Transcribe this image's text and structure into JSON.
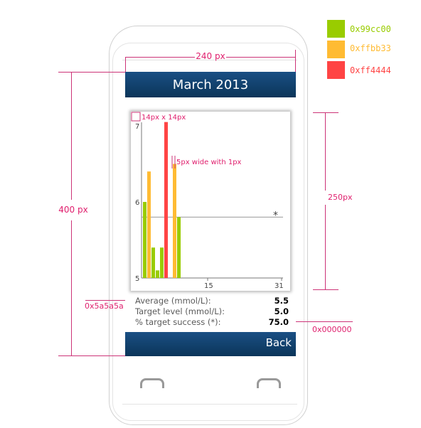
{
  "screen": {
    "title": "March 2013",
    "back_label": "Back"
  },
  "chart_data": {
    "type": "bar",
    "x_range": [
      1,
      31
    ],
    "x_ticks": [
      "15",
      "31"
    ],
    "y_range": [
      5,
      7
    ],
    "y_ticks": [
      "5",
      "6",
      "7"
    ],
    "target_value": 5.8,
    "target_marker": "*",
    "bars": [
      {
        "day": 1,
        "value": 6.0,
        "color": "#99cc00"
      },
      {
        "day": 2,
        "value": 6.4,
        "color": "#ffbb33"
      },
      {
        "day": 3,
        "value": 5.4,
        "color": "#99cc00"
      },
      {
        "day": 4,
        "value": 5.1,
        "color": "#99cc00"
      },
      {
        "day": 5,
        "value": 5.4,
        "color": "#99cc00"
      },
      {
        "day": 6,
        "value": 7.05,
        "color": "#ff4444"
      },
      {
        "day": 8,
        "value": 6.5,
        "color": "#ffbb33"
      },
      {
        "day": 9,
        "value": 5.8,
        "color": "#99cc00"
      }
    ]
  },
  "stats": [
    {
      "label": "Average (mmol/L):",
      "value": "5.5"
    },
    {
      "label": "Target level (mmol/L):",
      "value": "5.0"
    },
    {
      "label": "% target success (*):",
      "value": "75.0"
    }
  ],
  "annotations": {
    "width_label": "240 px",
    "height_label": "400 px",
    "chart_height_label": "250px",
    "marker_size_label": "14px x 14px",
    "bar_width_label": "5px wide with 1px",
    "text_color_label": "0x5a5a5a",
    "value_color_label": "0x000000"
  },
  "legend": [
    {
      "color": "#99cc00",
      "label": "0x99cc00"
    },
    {
      "color": "#ffbb33",
      "label": "0xffbb33"
    },
    {
      "color": "#ff4444",
      "label": "0xff4444"
    }
  ]
}
